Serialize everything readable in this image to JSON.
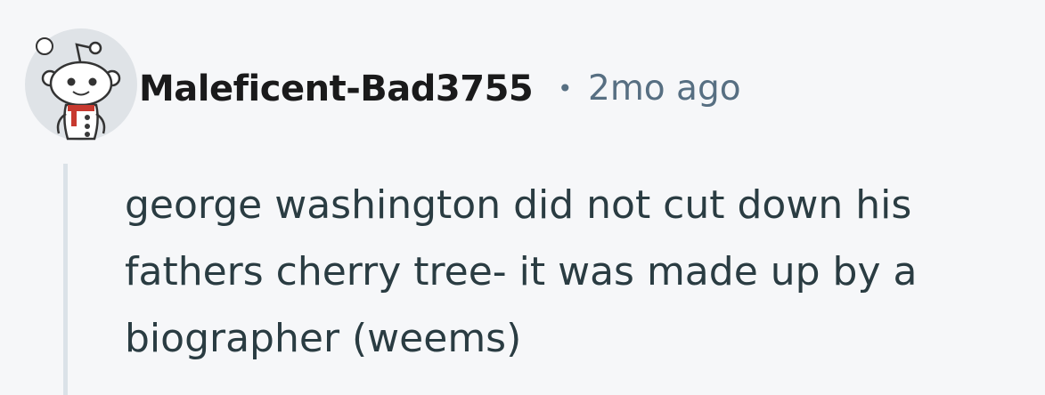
{
  "comment": {
    "author": "Maleficent-Bad3755",
    "separator": "•",
    "timestamp": "2mo ago",
    "body": "george washington did not cut down his fathers cherry tree- it was made up by a biographer (weems)"
  },
  "avatar": {
    "icon": "snoo-avatar-icon",
    "background_color": "#dfe3e7"
  },
  "colors": {
    "background": "#f6f7f9",
    "author_text": "#1a1a1b",
    "meta_text": "#576f82",
    "body_text": "#2a3c42",
    "thread_line": "#dbe2e8"
  }
}
